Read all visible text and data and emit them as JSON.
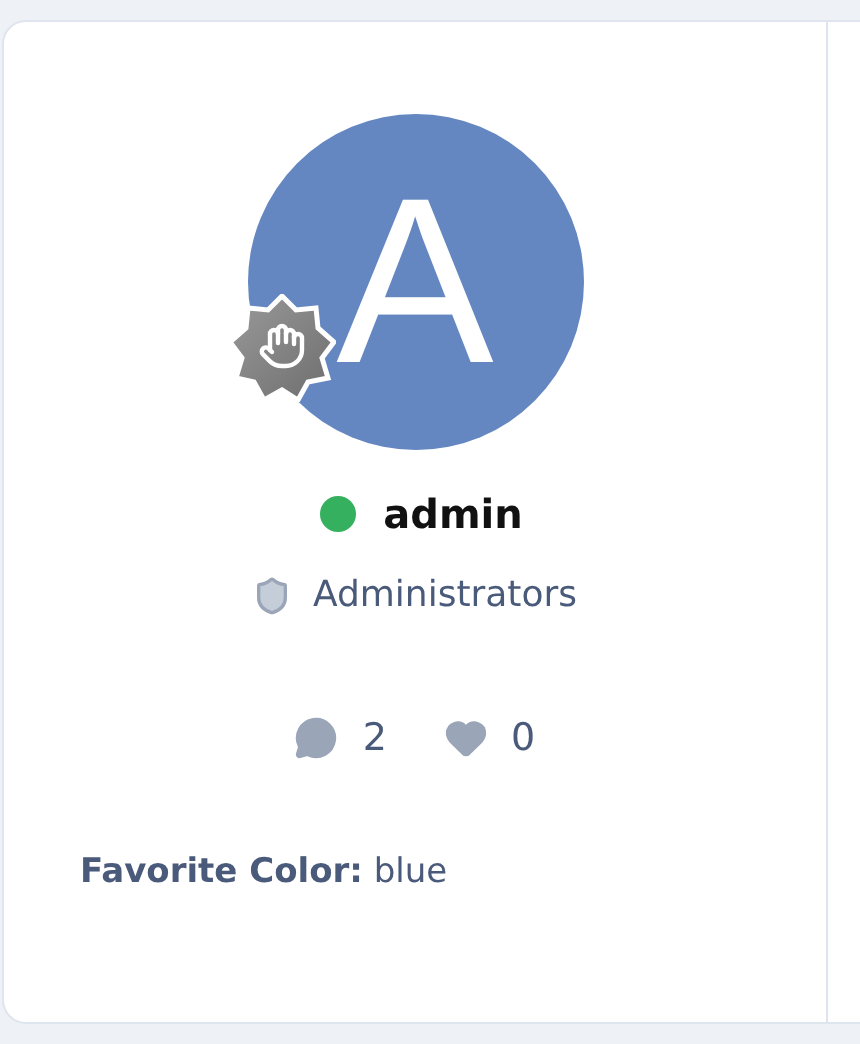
{
  "user": {
    "avatar_letter": "A",
    "name": "admin",
    "online": true,
    "group": "Administrators",
    "posts": "2",
    "likes": "0"
  },
  "fields": [
    {
      "label": "Favorite Color:",
      "value": "blue"
    }
  ]
}
